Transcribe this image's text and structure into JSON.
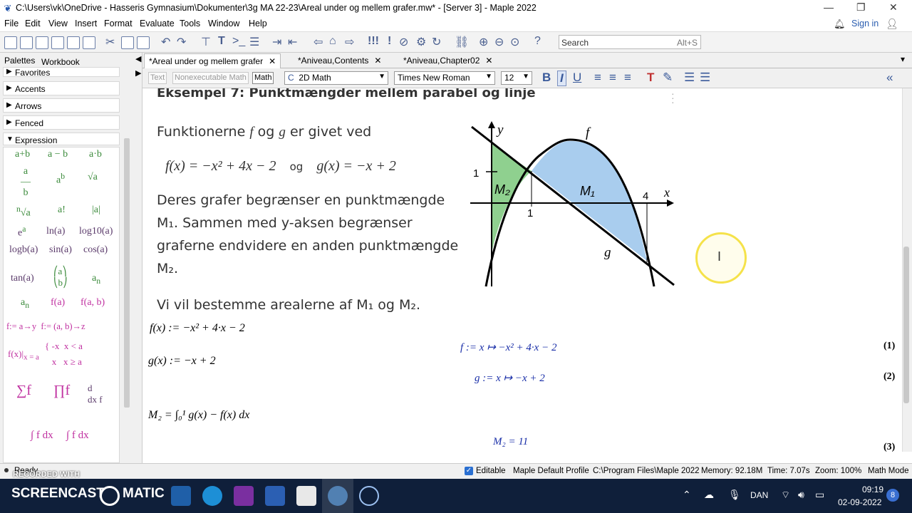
{
  "window": {
    "title": "C:\\Users\\vk\\OneDrive - Hasseris Gymnasium\\Dokumenter\\3g MA 22-23\\Areal under og mellem grafer.mw* - [Server 3] - Maple 2022"
  },
  "menu": [
    "File",
    "Edit",
    "View",
    "Insert",
    "Format",
    "Evaluate",
    "Tools",
    "Window",
    "Help"
  ],
  "account": {
    "sign_in": "Sign in"
  },
  "search": {
    "placeholder": "Search",
    "hotkey": "Alt+S"
  },
  "palettes": {
    "tabs": [
      "Palettes",
      "Workbook"
    ],
    "sections": [
      "Favorites",
      "Accents",
      "Arrows",
      "Fenced",
      "Expression"
    ],
    "expression_items": [
      "a+b",
      "a − b",
      "a·b",
      "ln(a)",
      "log10(a)",
      "logb(a)",
      "sin(a)",
      "cos(a)",
      "tan(a)",
      "f(a)",
      "f(a, b)",
      "e^a",
      "a!",
      "|a|"
    ]
  },
  "doc_tabs": [
    {
      "label": "*Areal under og mellem grafer",
      "active": true
    },
    {
      "label": "*Aniveau,Contents",
      "active": false
    },
    {
      "label": "*Aniveau,Chapter02",
      "active": false
    }
  ],
  "format_bar": {
    "mode_text": "Text",
    "mode_nonexec": "Nonexecutable Math",
    "mode_math": "Math",
    "style": "2D Math",
    "font": "Times New Roman",
    "size": "12"
  },
  "document": {
    "heading": "Eksempel 7: Punktmængder mellem parabel og linje",
    "p1": "Funktionerne",
    "p1_f": "f",
    "p1_og": "og",
    "p1_g": "g",
    "p1_end": "er givet ved",
    "eq_f": "f(x) = −x² + 4x − 2",
    "eq_og": "og",
    "eq_g": "g(x) = −x + 2",
    "p2_line1": "Deres grafer begrænser en punktmængde",
    "p2_line2": "M₁. Sammen med y-aksen begrænser",
    "p2_line3": "graferne endvidere en anden punktmængde",
    "p2_line4": "M₂.",
    "p3": "Vi vil bestemme arealerne af M₁ og M₂.",
    "input1": "f(x) := −x² + 4·x − 2",
    "input2": "g(x) := −x + 2",
    "input3": "M₂ = ∫₀¹ g(x) − f(x) dx",
    "output1": "f := x ↦ −x² + 4·x − 2",
    "output2": "g := x ↦ −x + 2",
    "output3": "M₂ = 11",
    "labels": [
      "(1)",
      "(2)",
      "(3)"
    ]
  },
  "figure": {
    "axis_y": "y",
    "axis_x": "x",
    "label_f": "f",
    "label_g": "g",
    "label_M1": "M₁",
    "label_M2": "M₂",
    "tick_y1": "1",
    "tick_x1": "1",
    "tick_x4": "4",
    "color_M1": "#a9cdee",
    "color_M2": "#8fd08f"
  },
  "status": {
    "ready": "Ready",
    "editable": "Editable",
    "profile": "Maple Default Profile",
    "path": "C:\\Program Files\\Maple 2022",
    "memory": "Memory: 92.18M",
    "time": "Time: 7.07s",
    "zoom": "Zoom: 100%",
    "mode": "Math Mode"
  },
  "taskbar": {
    "watermark": "RECORDED WITH",
    "watermark2": "SCREENCAST",
    "watermark3": "MATIC",
    "lang": "DAN",
    "clock_time": "09:19",
    "clock_date": "02-09-2022",
    "notif": "8"
  }
}
